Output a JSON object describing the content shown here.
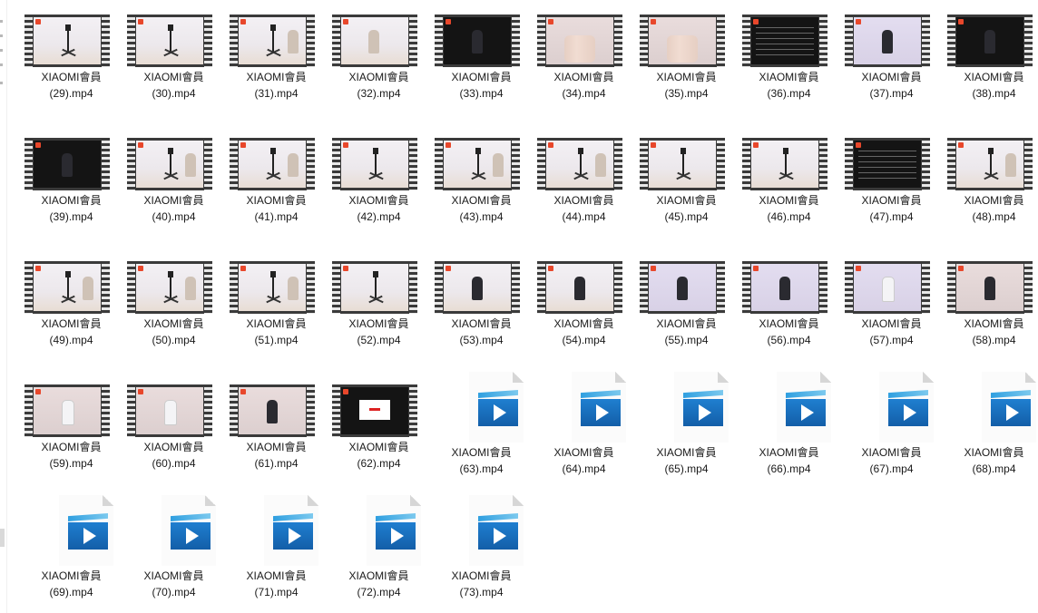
{
  "window": {
    "view": "large-icons",
    "accent_color": "#1f7fd0"
  },
  "files": [
    {
      "name": "XIAOMI會員",
      "suffix": "(29).mp4",
      "kind": "thumb",
      "style": "light",
      "scene": "tripod"
    },
    {
      "name": "XIAOMI會員",
      "suffix": "(30).mp4",
      "kind": "thumb",
      "style": "light",
      "scene": "tripod"
    },
    {
      "name": "XIAOMI會員",
      "suffix": "(31).mp4",
      "kind": "thumb",
      "style": "light",
      "scene": "tripod-person"
    },
    {
      "name": "XIAOMI會員",
      "suffix": "(32).mp4",
      "kind": "thumb",
      "style": "light",
      "scene": "person"
    },
    {
      "name": "XIAOMI會員",
      "suffix": "(33).mp4",
      "kind": "thumb",
      "style": "dark",
      "scene": "person-dark"
    },
    {
      "name": "XIAOMI會員",
      "suffix": "(34).mp4",
      "kind": "thumb",
      "style": "pinkish",
      "scene": "legs"
    },
    {
      "name": "XIAOMI會員",
      "suffix": "(35).mp4",
      "kind": "thumb",
      "style": "pinkish",
      "scene": "legs"
    },
    {
      "name": "XIAOMI會員",
      "suffix": "(36).mp4",
      "kind": "thumb",
      "style": "dark",
      "scene": "text"
    },
    {
      "name": "XIAOMI會員",
      "suffix": "(37).mp4",
      "kind": "thumb",
      "style": "lilac",
      "scene": "person-dark"
    },
    {
      "name": "XIAOMI會員",
      "suffix": "(38).mp4",
      "kind": "thumb",
      "style": "dark",
      "scene": "person-dark"
    },
    {
      "name": "XIAOMI會員",
      "suffix": "(39).mp4",
      "kind": "thumb",
      "style": "dark",
      "scene": "person-dark"
    },
    {
      "name": "XIAOMI會員",
      "suffix": "(40).mp4",
      "kind": "thumb",
      "style": "light",
      "scene": "tripod-person"
    },
    {
      "name": "XIAOMI會員",
      "suffix": "(41).mp4",
      "kind": "thumb",
      "style": "light",
      "scene": "tripod-person"
    },
    {
      "name": "XIAOMI會員",
      "suffix": "(42).mp4",
      "kind": "thumb",
      "style": "light",
      "scene": "tripod"
    },
    {
      "name": "XIAOMI會員",
      "suffix": "(43).mp4",
      "kind": "thumb",
      "style": "light",
      "scene": "tripod-person"
    },
    {
      "name": "XIAOMI會員",
      "suffix": "(44).mp4",
      "kind": "thumb",
      "style": "light",
      "scene": "tripod-person"
    },
    {
      "name": "XIAOMI會員",
      "suffix": "(45).mp4",
      "kind": "thumb",
      "style": "light",
      "scene": "tripod"
    },
    {
      "name": "XIAOMI會員",
      "suffix": "(46).mp4",
      "kind": "thumb",
      "style": "light",
      "scene": "tripod"
    },
    {
      "name": "XIAOMI會員",
      "suffix": "(47).mp4",
      "kind": "thumb",
      "style": "dark",
      "scene": "text"
    },
    {
      "name": "XIAOMI會員",
      "suffix": "(48).mp4",
      "kind": "thumb",
      "style": "light",
      "scene": "tripod-person"
    },
    {
      "name": "XIAOMI會員",
      "suffix": "(49).mp4",
      "kind": "thumb",
      "style": "light",
      "scene": "tripod-person"
    },
    {
      "name": "XIAOMI會員",
      "suffix": "(50).mp4",
      "kind": "thumb",
      "style": "light",
      "scene": "tripod-person"
    },
    {
      "name": "XIAOMI會員",
      "suffix": "(51).mp4",
      "kind": "thumb",
      "style": "light",
      "scene": "tripod-person"
    },
    {
      "name": "XIAOMI會員",
      "suffix": "(52).mp4",
      "kind": "thumb",
      "style": "light",
      "scene": "tripod"
    },
    {
      "name": "XIAOMI會員",
      "suffix": "(53).mp4",
      "kind": "thumb",
      "style": "light",
      "scene": "person-dark"
    },
    {
      "name": "XIAOMI會員",
      "suffix": "(54).mp4",
      "kind": "thumb",
      "style": "light",
      "scene": "person-dark"
    },
    {
      "name": "XIAOMI會員",
      "suffix": "(55).mp4",
      "kind": "thumb",
      "style": "lilac",
      "scene": "person-dark"
    },
    {
      "name": "XIAOMI會員",
      "suffix": "(56).mp4",
      "kind": "thumb",
      "style": "lilac",
      "scene": "person-dark"
    },
    {
      "name": "XIAOMI會員",
      "suffix": "(57).mp4",
      "kind": "thumb",
      "style": "lilac",
      "scene": "person-white"
    },
    {
      "name": "XIAOMI會員",
      "suffix": "(58).mp4",
      "kind": "thumb",
      "style": "pinkish",
      "scene": "person-dark"
    },
    {
      "name": "XIAOMI會員",
      "suffix": "(59).mp4",
      "kind": "thumb",
      "style": "pinkish",
      "scene": "person-white"
    },
    {
      "name": "XIAOMI會員",
      "suffix": "(60).mp4",
      "kind": "thumb",
      "style": "pinkish",
      "scene": "person-white"
    },
    {
      "name": "XIAOMI會員",
      "suffix": "(61).mp4",
      "kind": "thumb",
      "style": "pinkish",
      "scene": "person-dark"
    },
    {
      "name": "XIAOMI會員",
      "suffix": "(62).mp4",
      "kind": "thumb",
      "style": "dark",
      "scene": "card"
    },
    {
      "name": "XIAOMI會員",
      "suffix": "(63).mp4",
      "kind": "doc"
    },
    {
      "name": "XIAOMI會員",
      "suffix": "(64).mp4",
      "kind": "doc"
    },
    {
      "name": "XIAOMI會員",
      "suffix": "(65).mp4",
      "kind": "doc"
    },
    {
      "name": "XIAOMI會員",
      "suffix": "(66).mp4",
      "kind": "doc"
    },
    {
      "name": "XIAOMI會員",
      "suffix": "(67).mp4",
      "kind": "doc"
    },
    {
      "name": "XIAOMI會員",
      "suffix": "(68).mp4",
      "kind": "doc"
    },
    {
      "name": "XIAOMI會員",
      "suffix": "(69).mp4",
      "kind": "doc"
    },
    {
      "name": "XIAOMI會員",
      "suffix": "(70).mp4",
      "kind": "doc"
    },
    {
      "name": "XIAOMI會員",
      "suffix": "(71).mp4",
      "kind": "doc"
    },
    {
      "name": "XIAOMI會員",
      "suffix": "(72).mp4",
      "kind": "doc"
    },
    {
      "name": "XIAOMI會員",
      "suffix": "(73).mp4",
      "kind": "doc"
    }
  ]
}
